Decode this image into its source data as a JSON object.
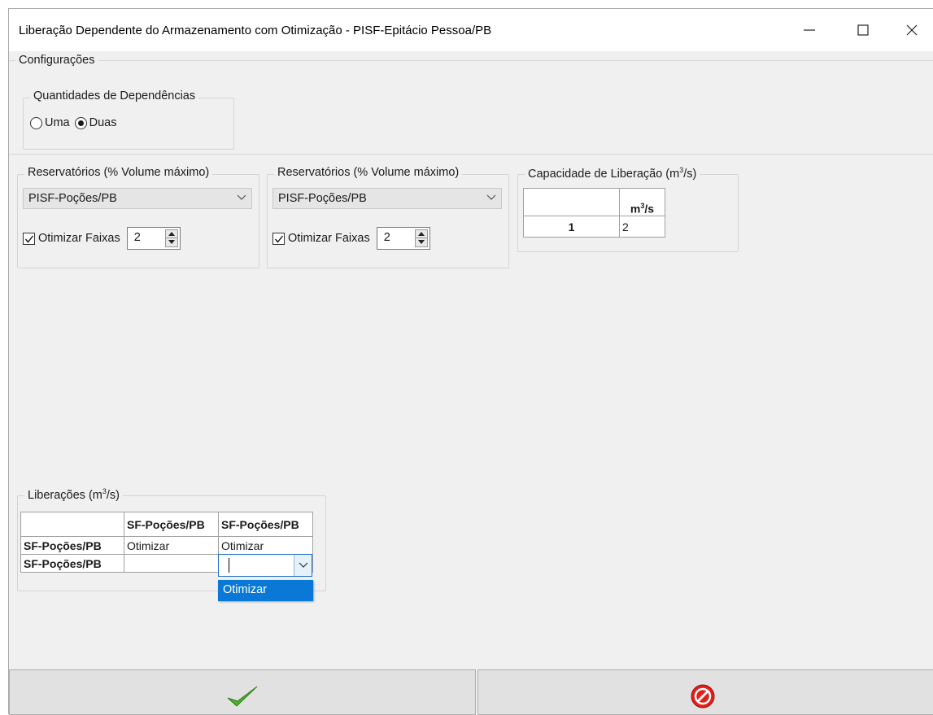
{
  "window": {
    "title": "Liberação Dependente do Armazenamento com Otimização - PISF-Epitácio Pessoa/PB",
    "minimize_glyph": "—",
    "maximize_glyph": "☐",
    "close_glyph": "✕"
  },
  "configuracoes": {
    "legend": "Configurações",
    "dependencias": {
      "legend": "Quantidades de Dependências",
      "options": [
        {
          "label": "Uma",
          "checked": false
        },
        {
          "label": "Duas",
          "checked": true
        }
      ]
    }
  },
  "reservatorios": [
    {
      "legend": "Reservatórios (% Volume máximo)",
      "selected": "PISF-Poções/PB",
      "otimizar_label": "Otimizar Faixas",
      "otimizar_checked": true,
      "faixas_value": "2"
    },
    {
      "legend": "Reservatórios (% Volume máximo)",
      "selected": "PISF-Poções/PB",
      "otimizar_label": "Otimizar Faixas",
      "otimizar_checked": true,
      "faixas_value": "2"
    }
  ],
  "capacidade": {
    "legend_prefix": "Capacidade de Liberação (m",
    "legend_sup": "3",
    "legend_suffix": "/s)",
    "col_header_prefix": "m",
    "col_header_sup": "3",
    "col_header_suffix": "/s",
    "rows": [
      {
        "label": "1",
        "value": "2"
      }
    ]
  },
  "liberacoes": {
    "legend_prefix": "Liberações (m",
    "legend_sup": "3",
    "legend_suffix": "/s)",
    "col_headers": [
      "SF-Poções/PB",
      "SF-Poções/PB"
    ],
    "rows": [
      {
        "label": "SF-Poções/PB",
        "cells": [
          "Otimizar",
          "Otimizar"
        ]
      },
      {
        "label": "SF-Poções/PB",
        "cells": [
          "",
          ""
        ]
      }
    ],
    "dropdown_options": [
      "Otimizar"
    ]
  },
  "buttons": {
    "ok_icon": "checkmark-icon",
    "cancel_icon": "cancel-icon",
    "ok_color": "#4caf2a",
    "cancel_color": "#e0201a"
  },
  "colors": {
    "window_bg": "#f0f0f0",
    "selection_blue": "#0a78d7"
  }
}
